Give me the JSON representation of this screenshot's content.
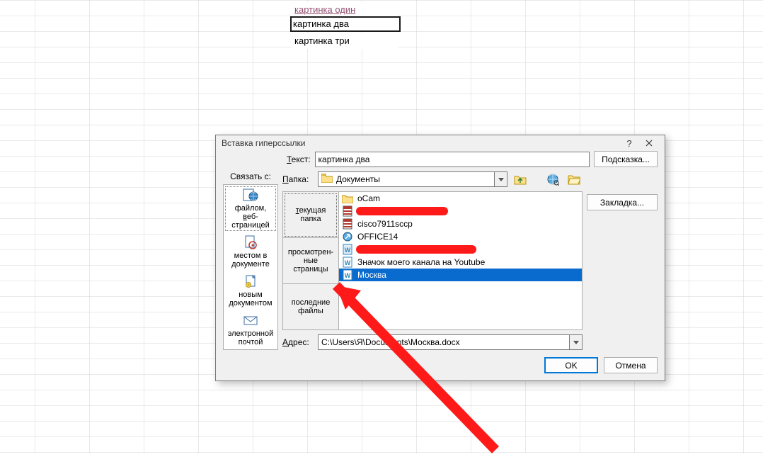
{
  "cells": {
    "a": "картинка один",
    "b": "картинка два",
    "c": "картинка три"
  },
  "dialog": {
    "title": "Вставка гиперссылки",
    "linkwith_label": "Связать с:",
    "linkwith": {
      "file": "файлом, веб-страницей",
      "place": "местом в документе",
      "newdoc": "новым документом",
      "email": "электронной почтой"
    },
    "text_label": "Текст:",
    "text_value": "картинка два",
    "tooltip_btn": "Подсказка...",
    "folder_label": "Папка:",
    "folder_value": "Документы",
    "tabs": {
      "current": "текущая папка",
      "browsed": "просмотрен-ные страницы",
      "recent": "последние файлы"
    },
    "files": {
      "f0": "oCam",
      "f1": "",
      "f2": "cisco7911sccp",
      "f3": "OFFICE14",
      "f4": "",
      "f5": "Значок моего канала на Youtube",
      "f6": "Москва"
    },
    "address_label": "Адрес:",
    "address_value": "C:\\Users\\Я\\Documents\\Москва.docx",
    "bookmark_btn": "Закладка...",
    "ok": "OK",
    "cancel": "Отмена"
  },
  "underlined": {
    "file": "в",
    "text": "Т",
    "folder": "П",
    "current": "т",
    "address": "А"
  }
}
